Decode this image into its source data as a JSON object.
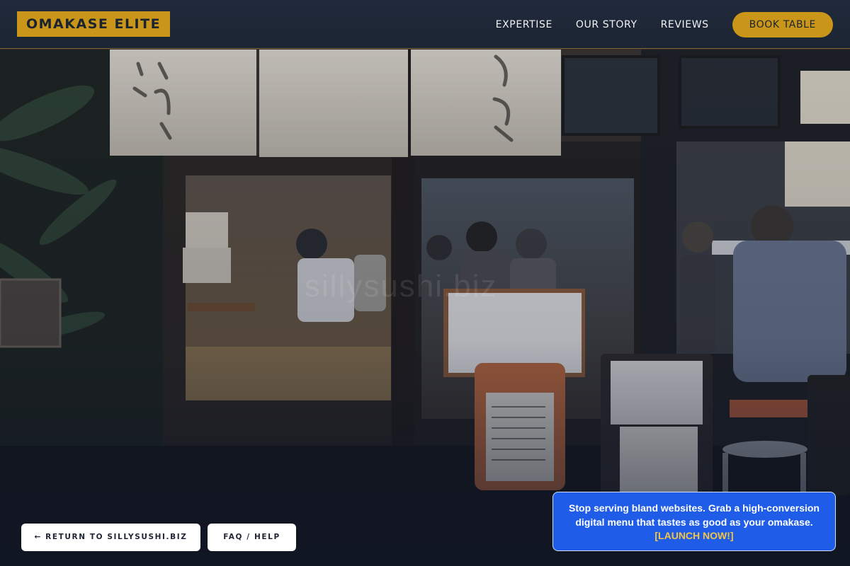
{
  "header": {
    "logo": "OMAKASE ELITE",
    "nav": [
      {
        "label": "EXPERTISE"
      },
      {
        "label": "OUR STORY"
      },
      {
        "label": "REVIEWS"
      }
    ],
    "cta": "BOOK TABLE"
  },
  "hero": {
    "watermark": "sillysushi.biz"
  },
  "footer": {
    "return_label": "← RETURN TO SILLYSUSHI.BIZ",
    "faq_label": "FAQ / HELP"
  },
  "promo": {
    "text": "Stop serving bland websites. Grab a high-conversion digital menu that tastes as good as your omakase.",
    "link": "[LAUNCH NOW!]"
  },
  "colors": {
    "accent_gold": "#c9961a",
    "header_bg": "#1f2838",
    "promo_blue": "#1f5de8",
    "promo_link": "#f5c542"
  }
}
